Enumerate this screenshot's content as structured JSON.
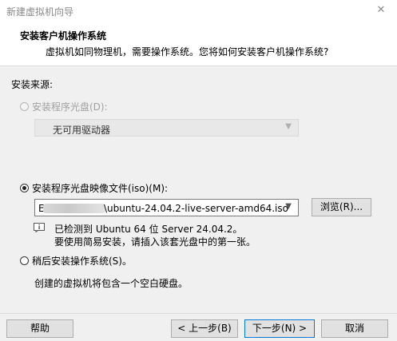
{
  "window": {
    "title": "新建虚拟机向导",
    "close_glyph": "✕"
  },
  "header": {
    "title": "安装客户机操作系统",
    "subtitle": "虚拟机如同物理机，需要操作系统。您将如何安装客户机操作系统?"
  },
  "source_label": "安装来源:",
  "options": {
    "disc": {
      "label": "安装程序光盘(D):",
      "selected": false,
      "enabled": false
    },
    "disc_select_value": "无可用驱动器",
    "iso": {
      "label": "安装程序光盘映像文件(iso)(M):",
      "selected": true,
      "enabled": true
    },
    "iso_path_prefix": "E",
    "iso_path": "\\ubuntu-24.04.2-live-server-amd64.iso",
    "browse_label": "浏览(R)...",
    "detect_line1": "已检测到 Ubuntu 64 位 Server 24.04.2。",
    "detect_line2": "要使用简易安装，请插入该套光盘中的第一张。",
    "later": {
      "label": "稍后安装操作系统(S)。",
      "selected": false,
      "enabled": true
    },
    "later_desc": "创建的虚拟机将包含一个空白硬盘。"
  },
  "footer": {
    "help": "帮助",
    "back": "< 上一步(B)",
    "next": "下一步(N) >",
    "cancel": "取消"
  }
}
